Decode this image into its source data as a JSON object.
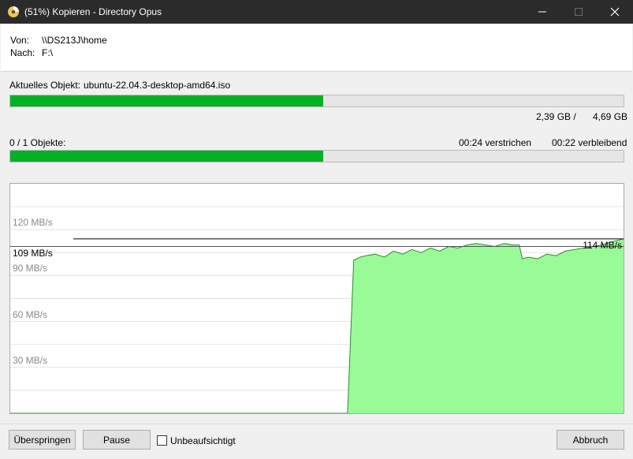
{
  "window": {
    "title": "(51%) Kopieren - Directory Opus",
    "icon": "directory-opus-icon",
    "controls": [
      "minimize-icon",
      "maximize-icon",
      "close-icon"
    ]
  },
  "paths": {
    "from_label": "Von:",
    "from_value": "\\\\DS213J\\home",
    "to_label": "Nach:",
    "to_value": "F:\\"
  },
  "current_object": {
    "label": "Aktuelles Objekt:",
    "value": "ubuntu-22.04.3-desktop-amd64.iso",
    "progress": 0.51,
    "copied": "2,39 GB /",
    "total": "4,69 GB"
  },
  "overall": {
    "count_label": "0 / 1 Objekte:",
    "elapsed": "00:24 verstrichen",
    "remaining": "00:22 verbleibend",
    "progress": 0.51
  },
  "colors": {
    "progress_fill": "#06b025",
    "graph_fill": "#98fb98",
    "graph_stroke": "#2e8b2e",
    "titlebar": "#2b2b2b"
  },
  "chart_data": {
    "type": "area",
    "y_unit": "MB/s",
    "ylim": [
      0,
      150
    ],
    "y_ticks": [
      {
        "value": 30,
        "label": "30 MB/s"
      },
      {
        "value": 60,
        "label": "60 MB/s"
      },
      {
        "value": 90,
        "label": "90 MB/s"
      },
      {
        "value": 120,
        "label": "120 MB/s"
      }
    ],
    "grid": true,
    "average": {
      "value": 109,
      "label": "109 MB/s"
    },
    "current": {
      "value": 114,
      "label": "114 MB/s"
    },
    "series": [
      {
        "x": [
          0,
          0.55,
          0.56,
          0.57,
          0.58,
          0.595,
          0.61,
          0.625,
          0.64,
          0.655,
          0.67,
          0.685,
          0.7,
          0.715,
          0.73,
          0.745,
          0.76,
          0.775,
          0.79,
          0.805,
          0.82,
          0.83,
          0.835,
          0.845,
          0.86,
          0.875,
          0.89,
          0.905,
          0.92,
          0.935,
          0.95,
          0.965,
          0.98,
          0.99,
          1.0
        ],
        "values": [
          0,
          0,
          100,
          102,
          103,
          104,
          102,
          106,
          104,
          107,
          105,
          108,
          106,
          109,
          108,
          110,
          111,
          110,
          109,
          111,
          110,
          110,
          101,
          102,
          101,
          104,
          103,
          106,
          107,
          108,
          109,
          110,
          112,
          113,
          114
        ]
      }
    ]
  },
  "buttons": {
    "skip": "Überspringen",
    "pause": "Pause",
    "unattended": "Unbeaufsichtigt",
    "unattended_checked": false,
    "cancel": "Abbruch"
  }
}
